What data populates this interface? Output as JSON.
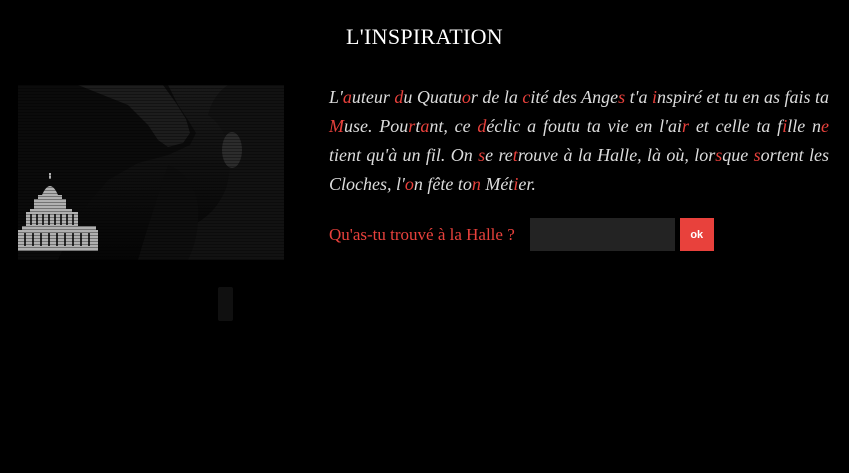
{
  "header": {
    "title": "L'INSPIRATION"
  },
  "story": {
    "segments": [
      {
        "text": "L'",
        "hl": false
      },
      {
        "text": "a",
        "hl": true
      },
      {
        "text": "uteur ",
        "hl": false
      },
      {
        "text": "d",
        "hl": true
      },
      {
        "text": "u Quatu",
        "hl": false
      },
      {
        "text": "o",
        "hl": true
      },
      {
        "text": "r de la ",
        "hl": false
      },
      {
        "text": "c",
        "hl": true
      },
      {
        "text": "ité des Ange",
        "hl": false
      },
      {
        "text": "s",
        "hl": true
      },
      {
        "text": " t'a ",
        "hl": false
      },
      {
        "text": "i",
        "hl": true
      },
      {
        "text": "nspiré et tu en as fais ta ",
        "hl": false
      },
      {
        "text": "M",
        "hl": true
      },
      {
        "text": "use. Pou",
        "hl": false
      },
      {
        "text": "r",
        "hl": true
      },
      {
        "text": "t",
        "hl": false
      },
      {
        "text": "a",
        "hl": true
      },
      {
        "text": "nt, ce ",
        "hl": false
      },
      {
        "text": "d",
        "hl": true
      },
      {
        "text": "éclic a foutu ta vie en l'ai",
        "hl": false
      },
      {
        "text": "r",
        "hl": true
      },
      {
        "text": " et celle ta f",
        "hl": false
      },
      {
        "text": "i",
        "hl": true
      },
      {
        "text": "lle n",
        "hl": false
      },
      {
        "text": "e",
        "hl": true
      },
      {
        "text": " tient qu'à un fil. On ",
        "hl": false
      },
      {
        "text": "s",
        "hl": true
      },
      {
        "text": "e re",
        "hl": false
      },
      {
        "text": "t",
        "hl": true
      },
      {
        "text": "rouve à la Halle, là où, lor",
        "hl": false
      },
      {
        "text": "s",
        "hl": true
      },
      {
        "text": "que ",
        "hl": false
      },
      {
        "text": "s",
        "hl": true
      },
      {
        "text": "ortent les Cloches, l'",
        "hl": false
      },
      {
        "text": "o",
        "hl": true
      },
      {
        "text": "n fête to",
        "hl": false
      },
      {
        "text": "n",
        "hl": true
      },
      {
        "text": " Mét",
        "hl": false
      },
      {
        "text": "i",
        "hl": true
      },
      {
        "text": "er.",
        "hl": false
      }
    ]
  },
  "form": {
    "question_label": "Qu'as-tu trouvé à la Halle ?",
    "answer_value": "",
    "ok_label": "ok"
  },
  "colors": {
    "background": "#000000",
    "accent": "#e8413c",
    "text": "#dcdcdc"
  }
}
